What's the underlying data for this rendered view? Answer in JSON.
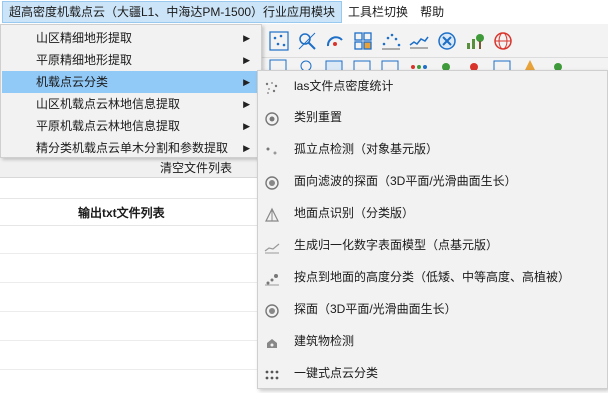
{
  "menubar": {
    "items": [
      {
        "label": "超高密度机载点云（大疆L1、中海达PM-1500）行业应用模块",
        "active": true
      },
      {
        "label": "工具栏切换",
        "active": false
      },
      {
        "label": "帮助",
        "active": false
      }
    ]
  },
  "dropdown": {
    "items": [
      {
        "label": "山区精细地形提取",
        "highlighted": false
      },
      {
        "label": "平原精细地形提取",
        "highlighted": false
      },
      {
        "label": "机载点云分类",
        "highlighted": true
      },
      {
        "label": "山区机载点云林地信息提取",
        "highlighted": false
      },
      {
        "label": "平原机载点云林地信息提取",
        "highlighted": false
      },
      {
        "label": "精分类机载点云单木分割和参数提取",
        "highlighted": false
      }
    ],
    "arrow_glyph": "▶"
  },
  "submenu": {
    "items": [
      {
        "label": "las文件点密度统计",
        "icon": "scatter-dots-icon"
      },
      {
        "label": "类别重置",
        "icon": "reset-circle-icon"
      },
      {
        "label": "孤立点检测（对象基元版）",
        "icon": "isolated-points-icon"
      },
      {
        "label": "面向滤波的探面（3D平面/光滑曲面生长）",
        "icon": "filter-circle-icon"
      },
      {
        "label": "地面点识别（分类版）",
        "icon": "ground-triangle-icon"
      },
      {
        "label": "生成归一化数字表面模型（点基元版）",
        "icon": "surface-model-icon"
      },
      {
        "label": "按点到地面的高度分类（低矮、中等高度、高植被）",
        "icon": "height-class-icon"
      },
      {
        "label": "探面（3D平面/光滑曲面生长）",
        "icon": "plane-detect-icon"
      },
      {
        "label": "建筑物检测",
        "icon": "building-icon"
      },
      {
        "label": "一键式点云分类",
        "icon": "one-click-classify-icon"
      }
    ]
  },
  "background": {
    "clear_button": "清空文件列表",
    "list_header": "输出txt文件列表"
  },
  "colors": {
    "highlight": "#91c9f7",
    "menu_active": "#cce4f7",
    "menu_bg": "#f2f2f2"
  }
}
